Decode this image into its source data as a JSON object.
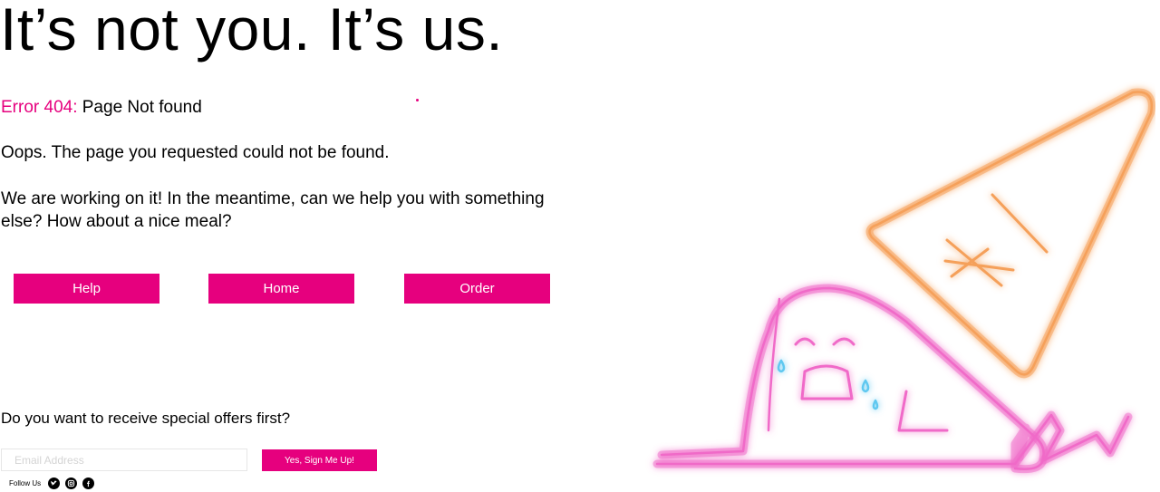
{
  "hero": {
    "headline": "It’s not you. It’s us.",
    "error_code": "Error 404:",
    "error_text": " Page Not found",
    "paragraph1": "Oops. The page you requested could not be found.",
    "paragraph2": "We are working on it! In the meantime, can we help you with something else? How about a nice meal?"
  },
  "actions": {
    "help_label": "Help",
    "home_label": "Home",
    "order_label": "Order"
  },
  "newsletter": {
    "prompt": "Do you want to receive special offers first?",
    "email_placeholder": "Email Address",
    "signup_label": "Yes, Sign Me Up!"
  },
  "social": {
    "follow_label": "Follow Us",
    "icons": [
      "twitter-icon",
      "instagram-icon",
      "facebook-icon"
    ]
  },
  "colors": {
    "accent": "#e6007e",
    "neon_pink": "#f06ac8",
    "neon_orange": "#f5a05a",
    "neon_blue": "#5ec8f0"
  }
}
